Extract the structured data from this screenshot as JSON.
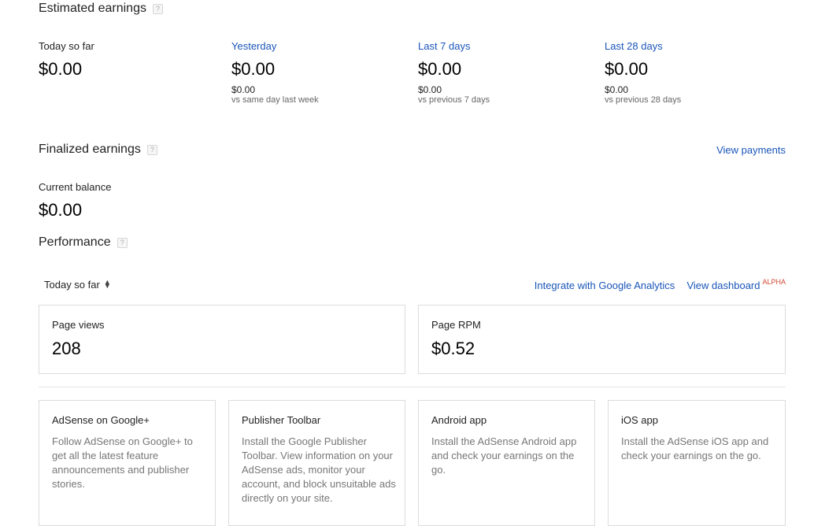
{
  "estimated": {
    "title": "Estimated earnings",
    "help": "?",
    "today": {
      "label": "Today so far",
      "value": "$0.00"
    },
    "yesterday": {
      "label": "Yesterday",
      "value": "$0.00",
      "compare_value": "$0.00",
      "compare_label": "vs same day last week"
    },
    "last7": {
      "label": "Last 7 days",
      "value": "$0.00",
      "compare_value": "$0.00",
      "compare_label": "vs previous 7 days"
    },
    "last28": {
      "label": "Last 28 days",
      "value": "$0.00",
      "compare_value": "$0.00",
      "compare_label": "vs previous 28 days"
    }
  },
  "finalized": {
    "title": "Finalized earnings",
    "help": "?",
    "view_payments": "View payments",
    "balance_label": "Current balance",
    "balance_value": "$0.00"
  },
  "performance": {
    "title": "Performance",
    "help": "?",
    "range_select": "Today so far",
    "range_arrows": "▲▼",
    "integrate_link": "Integrate with Google Analytics",
    "dashboard_link": "View dashboard",
    "dashboard_badge": "ALPHA",
    "page_views": {
      "label": "Page views",
      "value": "208"
    },
    "page_rpm": {
      "label": "Page RPM",
      "value": "$0.52"
    }
  },
  "cards": [
    {
      "title": "AdSense on Google+",
      "desc": "Follow AdSense on Google+ to get all the latest feature announcements and publisher stories."
    },
    {
      "title": "Publisher Toolbar",
      "desc": "Install the Google Publisher Toolbar. View information on your AdSense ads, monitor your account, and block unsuitable ads directly on your site."
    },
    {
      "title": "Android app",
      "desc": "Install the AdSense Android app and check your earnings on the go."
    },
    {
      "title": "iOS app",
      "desc": "Install the AdSense iOS app and check your earnings on the go."
    }
  ],
  "colors": {
    "link": "#1a55b8",
    "alpha": "#d14836",
    "border": "#dcdcdc"
  }
}
